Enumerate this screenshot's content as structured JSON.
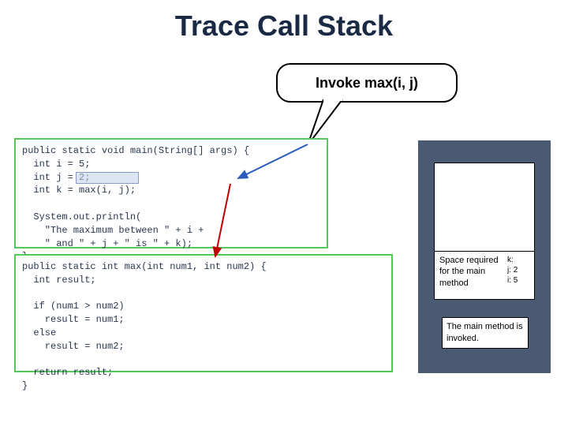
{
  "title": "Trace Call Stack",
  "callout": "Invoke max(i, j)",
  "code_main": "public static void main(String[] args) {\n  int i = 5;\n  int j = 2;\n  int k = max(i, j);\n\n  System.out.println(\n    \"The maximum between \" + i +\n    \" and \" + j + \" is \" + k);\n}",
  "code_max": "public static int max(int num1, int num2) {\n  int result;\n\n  if (num1 > num2)\n    result = num1;\n  else\n    result = num2;\n\n  return result;\n}",
  "stack": {
    "frame_label": "Space required for the main method",
    "vars": "k:\nj: 2\ni: 5",
    "note": "The main method is invoked."
  }
}
